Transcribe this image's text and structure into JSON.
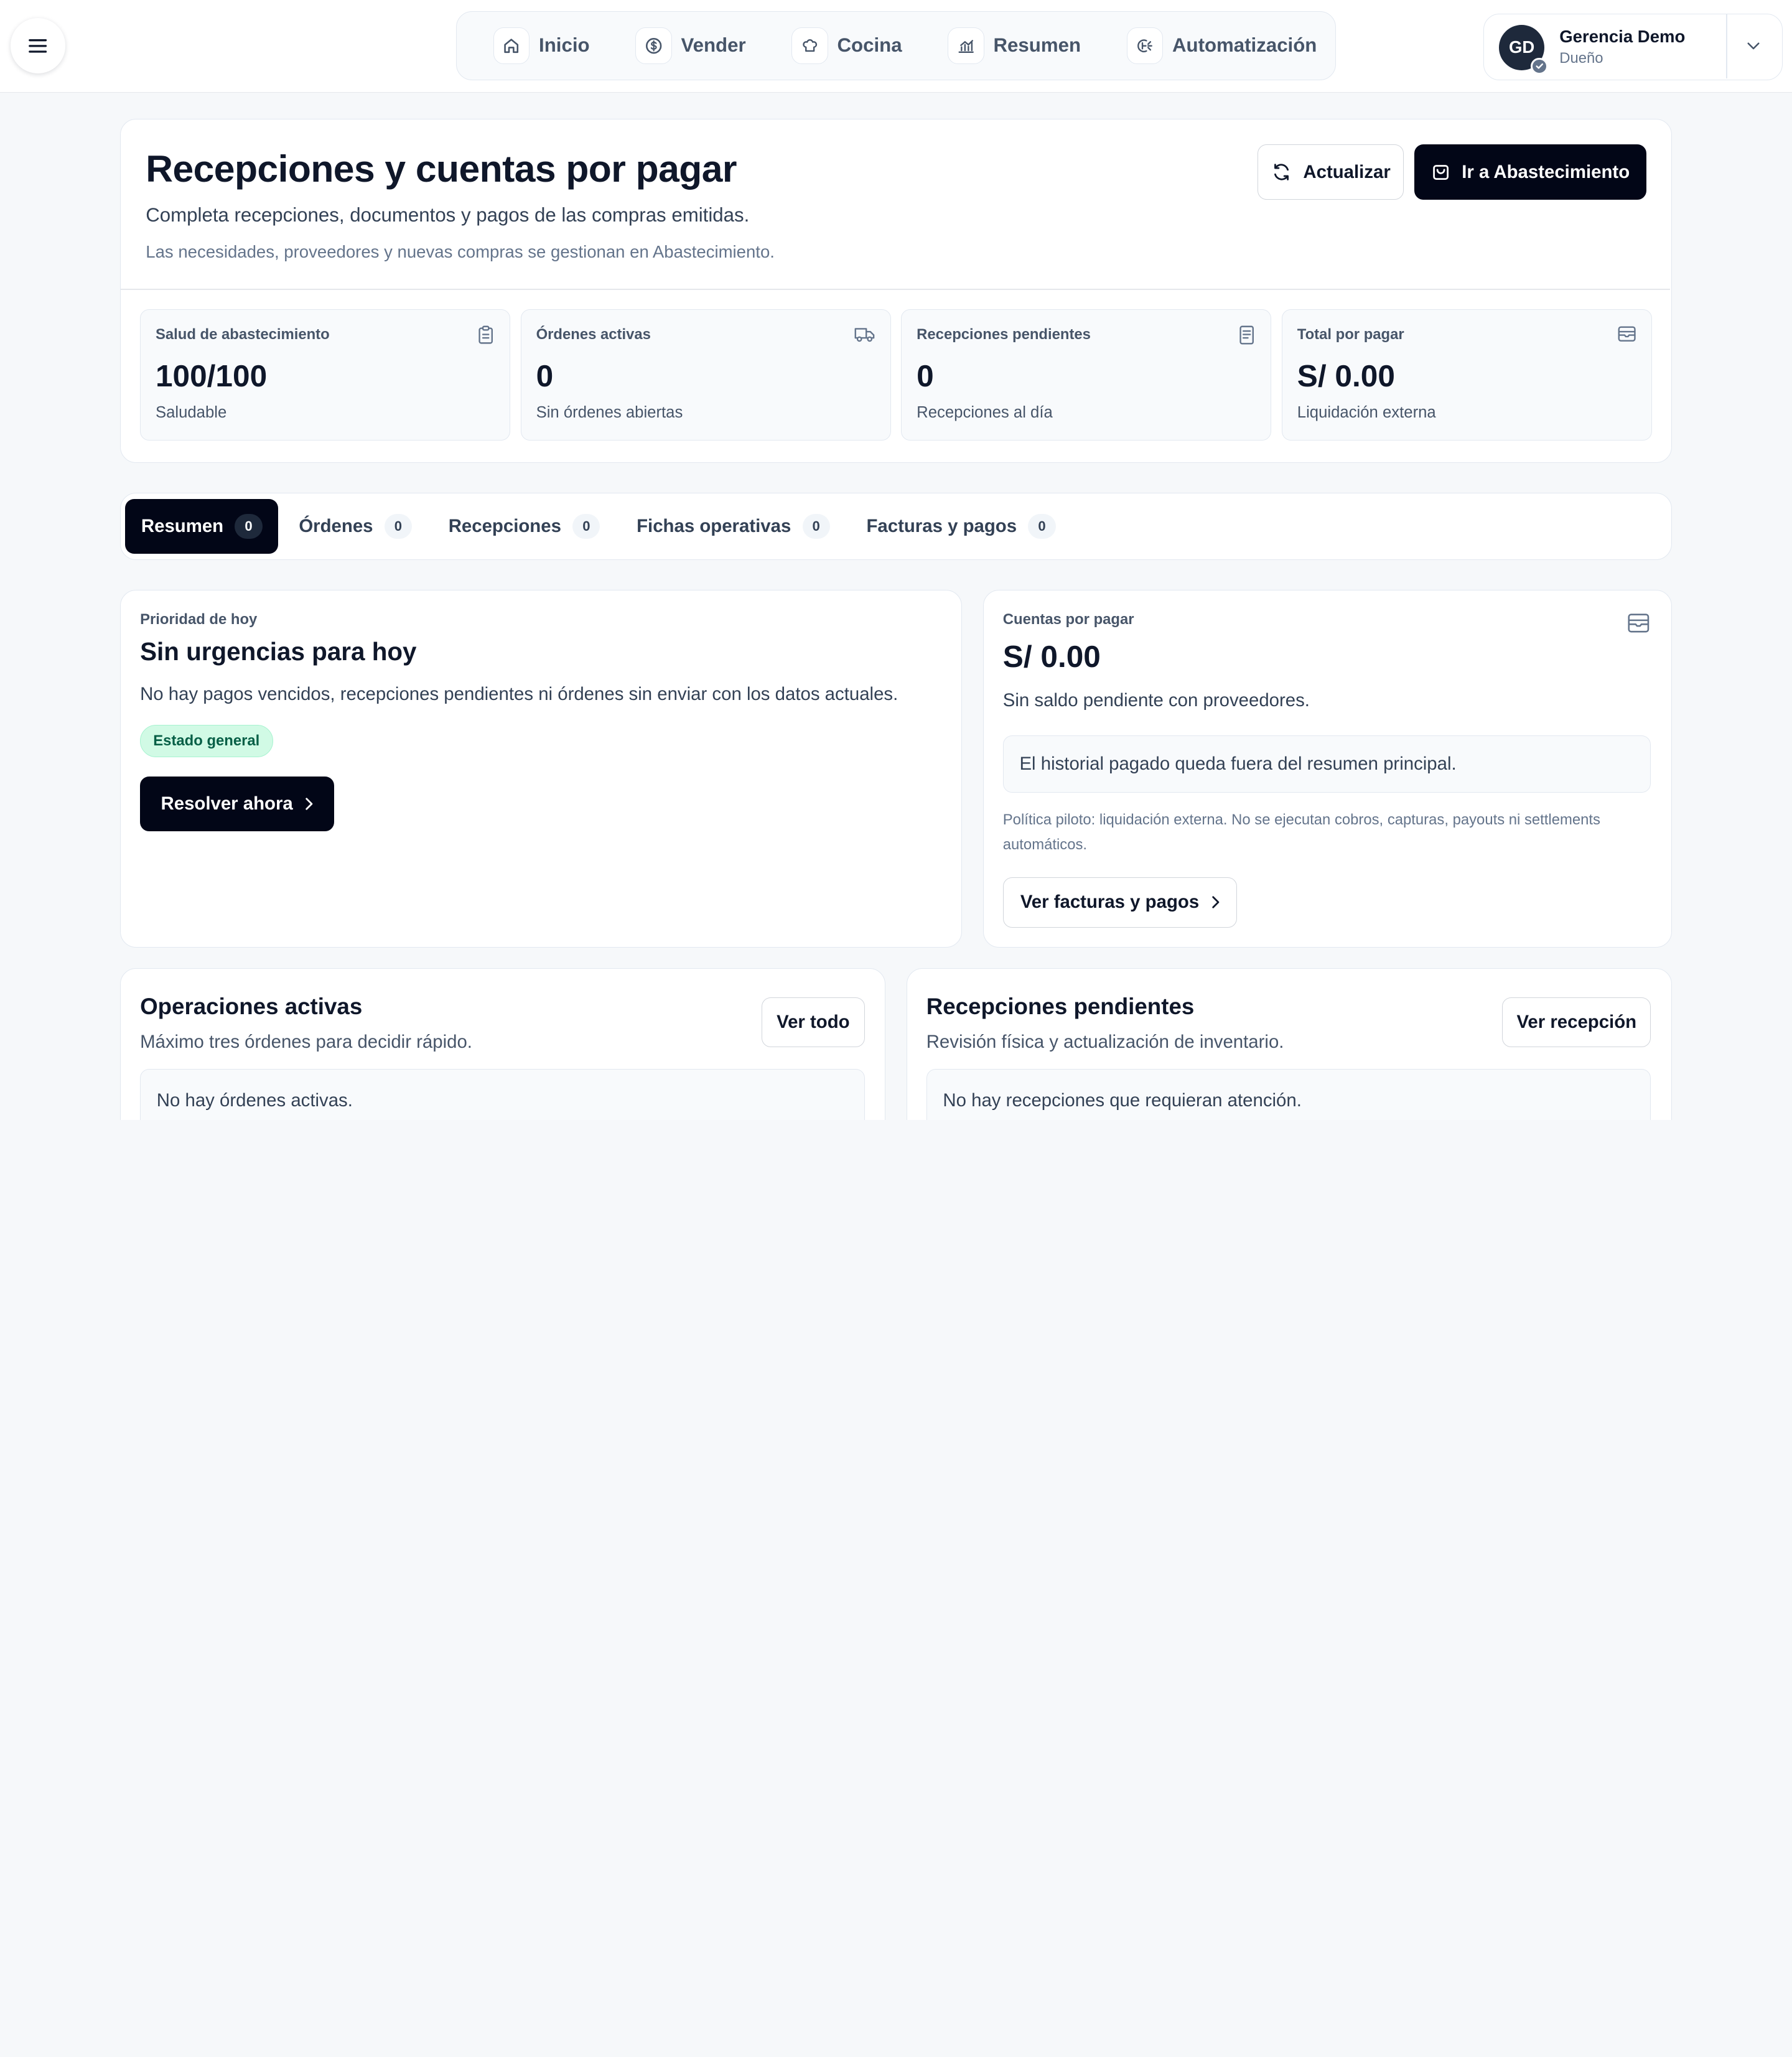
{
  "topbar": {
    "menu_icon": "hamburger-icon",
    "nav": [
      {
        "label": "Inicio",
        "icon": "home-icon"
      },
      {
        "label": "Vender",
        "icon": "dollar-circle-icon"
      },
      {
        "label": "Cocina",
        "icon": "chef-hat-icon"
      },
      {
        "label": "Resumen",
        "icon": "chart-icon"
      },
      {
        "label": "Automatización",
        "icon": "automation-icon"
      }
    ],
    "user": {
      "initials": "GD",
      "name": "Gerencia Demo",
      "role": "Dueño"
    }
  },
  "header": {
    "title": "Recepciones y cuentas por pagar",
    "subtitle": "Completa recepciones, documentos y pagos de las compras emitidas.",
    "note": "Las necesidades, proveedores y nuevas compras se gestionan en Abastecimiento.",
    "refresh_label": "Actualizar",
    "supply_label": "Ir a Abastecimiento"
  },
  "stats": [
    {
      "label": "Salud de abastecimiento",
      "value": "100/100",
      "note": "Saludable",
      "icon": "clipboard-icon"
    },
    {
      "label": "Órdenes activas",
      "value": "0",
      "note": "Sin órdenes abiertas",
      "icon": "truck-icon"
    },
    {
      "label": "Recepciones pendientes",
      "value": "0",
      "note": "Recepciones al día",
      "icon": "document-icon"
    },
    {
      "label": "Total por pagar",
      "value": "S/ 0.00",
      "note": "Liquidación externa",
      "icon": "wallet-icon"
    }
  ],
  "tabs": [
    {
      "label": "Resumen",
      "count": "0"
    },
    {
      "label": "Órdenes",
      "count": "0"
    },
    {
      "label": "Recepciones",
      "count": "0"
    },
    {
      "label": "Fichas operativas",
      "count": "0"
    },
    {
      "label": "Facturas y pagos",
      "count": "0"
    }
  ],
  "priority": {
    "kicker": "Prioridad de hoy",
    "title": "Sin urgencias para hoy",
    "text": "No hay pagos vencidos, recepciones pendientes ni órdenes sin enviar con los datos actuales.",
    "badge": "Estado general",
    "button": "Resolver ahora"
  },
  "payables": {
    "kicker": "Cuentas por pagar",
    "amount": "S/ 0.00",
    "text": "Sin saldo pendiente con proveedores.",
    "box": "El historial pagado queda fuera del resumen principal.",
    "policy": "Política piloto: liquidación externa. No se ejecutan cobros, capturas, payouts ni settlements automáticos.",
    "button": "Ver facturas y pagos"
  },
  "operations": {
    "title": "Operaciones activas",
    "subtitle": "Máximo tres órdenes para decidir rápido.",
    "button": "Ver todo",
    "empty": "No hay órdenes activas."
  },
  "receptions": {
    "title": "Recepciones pendientes",
    "subtitle": "Revisión física y actualización de inventario.",
    "button": "Ver recepción",
    "empty": "No hay recepciones que requieran atención."
  },
  "colors": {
    "primary_dark": "#020617",
    "success_bg": "#d1fae5",
    "success_text": "#065f46",
    "page_bg": "#f6f8fa"
  }
}
